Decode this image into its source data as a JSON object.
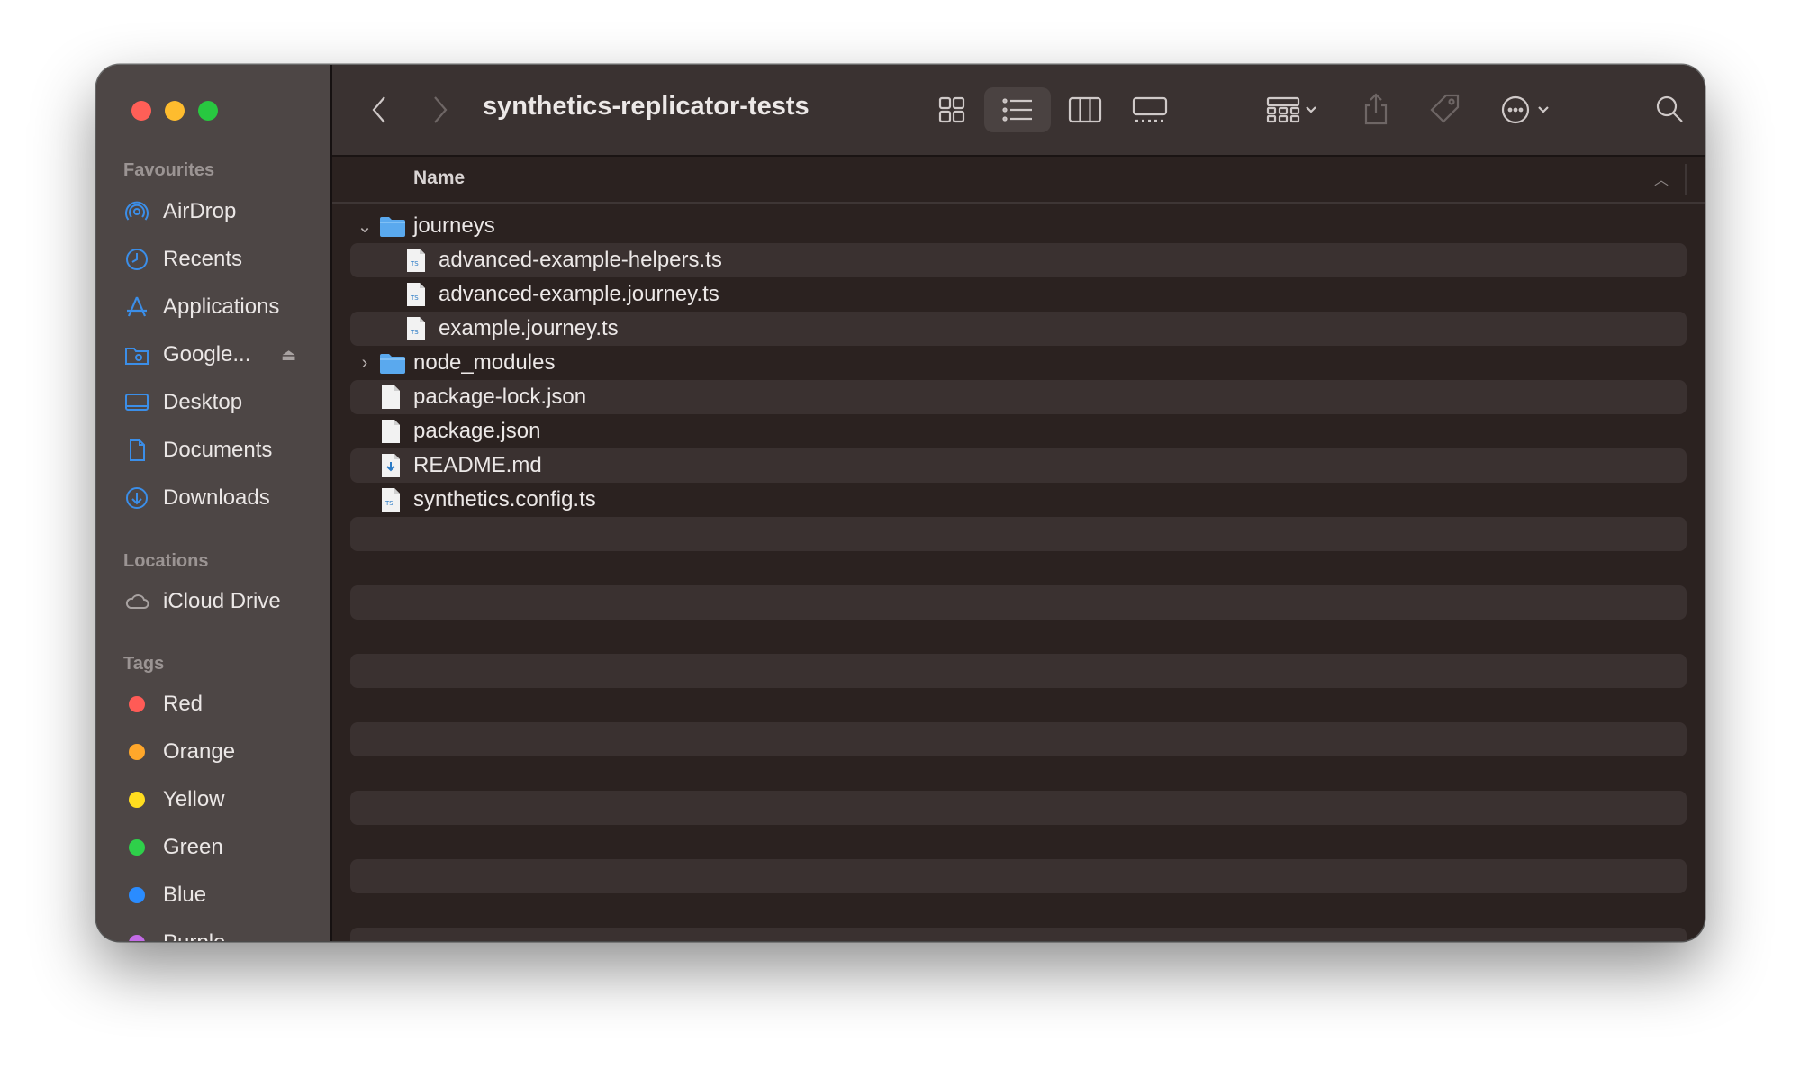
{
  "window": {
    "title": "synthetics-replicator-tests"
  },
  "sidebar": {
    "sections": {
      "favourites": "Favourites",
      "locations": "Locations",
      "tags": "Tags"
    },
    "favourites": [
      {
        "label": "AirDrop",
        "icon": "airdrop-icon"
      },
      {
        "label": "Recents",
        "icon": "clock-icon"
      },
      {
        "label": "Applications",
        "icon": "applications-icon"
      },
      {
        "label": "Google...",
        "icon": "drive-folder-icon"
      },
      {
        "label": "Desktop",
        "icon": "desktop-icon"
      },
      {
        "label": "Documents",
        "icon": "document-icon"
      },
      {
        "label": "Downloads",
        "icon": "download-icon"
      }
    ],
    "locations": [
      {
        "label": "iCloud Drive",
        "icon": "cloud-icon"
      }
    ],
    "tags": [
      {
        "label": "Red",
        "color": "#ff5b56"
      },
      {
        "label": "Orange",
        "color": "#ffa72a"
      },
      {
        "label": "Yellow",
        "color": "#ffdd1f"
      },
      {
        "label": "Green",
        "color": "#2ed04a"
      },
      {
        "label": "Blue",
        "color": "#2a8cff"
      },
      {
        "label": "Purple",
        "color": "#c36be6"
      }
    ]
  },
  "columns": {
    "name": "Name"
  },
  "files": [
    {
      "name": "journeys",
      "type": "folder",
      "expanded": true,
      "depth": 0
    },
    {
      "name": "advanced-example-helpers.ts",
      "type": "ts",
      "depth": 1
    },
    {
      "name": "advanced-example.journey.ts",
      "type": "ts",
      "depth": 1
    },
    {
      "name": "example.journey.ts",
      "type": "ts",
      "depth": 1
    },
    {
      "name": "node_modules",
      "type": "folder",
      "expanded": false,
      "depth": 0
    },
    {
      "name": "package-lock.json",
      "type": "file",
      "depth": 0
    },
    {
      "name": "package.json",
      "type": "file",
      "depth": 0
    },
    {
      "name": "README.md",
      "type": "md",
      "depth": 0
    },
    {
      "name": "synthetics.config.ts",
      "type": "ts",
      "depth": 0
    }
  ],
  "colors": {
    "accent": "#3b8ee8",
    "folder": "#5aa9ee"
  }
}
